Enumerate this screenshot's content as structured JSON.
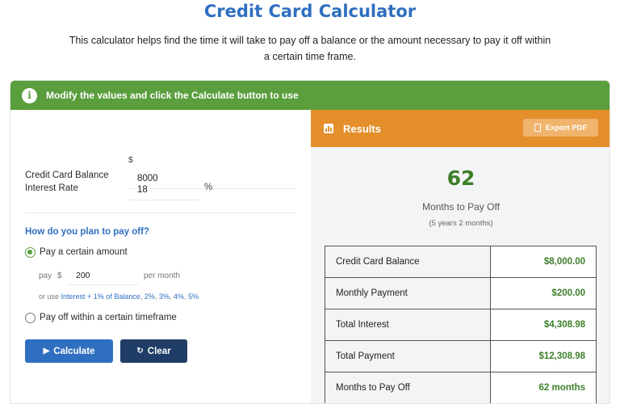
{
  "page": {
    "title": "Credit Card Calculator",
    "description": "This calculator helps find the time it will take to pay off a balance or the amount necessary to pay it off within a certain time frame."
  },
  "banner": {
    "text": "Modify the values and click the Calculate button to use"
  },
  "form": {
    "balance_label": "Credit Card Balance",
    "currency_symbol": "$",
    "balance_value": "8000",
    "interest_label": "Interest Rate",
    "interest_value": "18",
    "percent_symbol": "%",
    "question": "How do you plan to pay off?",
    "option_amount_label": "Pay a certain amount",
    "option_amount_selected": true,
    "pay_label": "pay",
    "pay_currency": "$",
    "pay_value": "200",
    "pay_unit": "per month",
    "hint_prefix": "or use",
    "hint_links": [
      "Interest + 1% of Balance",
      "2%",
      "3%",
      "4%",
      "5%"
    ],
    "option_timeframe_label": "Pay off within a certain timeframe",
    "option_timeframe_selected": false
  },
  "buttons": {
    "calculate": "Calculate",
    "clear": "Clear"
  },
  "results": {
    "header": "Results",
    "export_label": "Export PDF",
    "big_value": "62",
    "big_label": "Months to Pay Off",
    "big_sub": "(5 years 2 months)",
    "rows": [
      {
        "label": "Credit Card Balance",
        "value": "$8,000.00"
      },
      {
        "label": "Monthly Payment",
        "value": "$200.00"
      },
      {
        "label": "Total Interest",
        "value": "$4,308.98"
      },
      {
        "label": "Total Payment",
        "value": "$12,308.98"
      },
      {
        "label": "Months to Pay Off",
        "value": "62 months"
      }
    ]
  },
  "colors": {
    "primary_blue": "#2f6fc0",
    "banner_green": "#5a9e3d",
    "results_orange": "#e48f2c",
    "value_green": "#3d7f2a",
    "clear_navy": "#1f3d66"
  },
  "icons": {
    "banner": "info-icon",
    "results": "bar-chart-icon",
    "export": "document-icon",
    "calculate": "play-icon",
    "clear": "refresh-icon"
  }
}
